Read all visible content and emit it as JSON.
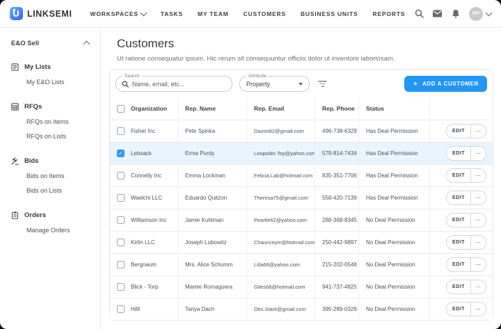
{
  "brand": {
    "name": "LINKSEMI"
  },
  "topnav": {
    "items": [
      "WORKSPACES",
      "TASKS",
      "MY TEAM",
      "CUSTOMERS",
      "BUSINESS UNITS",
      "REPORTS"
    ],
    "avatar_initials": "OP"
  },
  "sidebar": {
    "title": "E&O Sell",
    "sections": [
      {
        "label": "My Lists",
        "icon": "list-icon",
        "items": [
          "My E&O Lists"
        ]
      },
      {
        "label": "RFQs",
        "icon": "grid-icon",
        "items": [
          "RFQs on Items",
          "RFQs on Lists"
        ]
      },
      {
        "label": "Bids",
        "icon": "gavel-icon",
        "items": [
          "Bids on Items",
          "Bids on Lists"
        ]
      },
      {
        "label": "Orders",
        "icon": "clipboard-icon",
        "items": [
          "Manage Orders"
        ]
      }
    ]
  },
  "main": {
    "title": "Customers",
    "subtitle": "Ut ratione consequatur ipsum. Hic rerum sit consequuntur officiis dolor ut inventore laboriosam.",
    "toolbar": {
      "search_label": "Search",
      "search_placeholder": "Name, email, etc...",
      "attribute_label": "Attribute",
      "attribute_value": "Property",
      "add_button": "ADD A CUSTOMER"
    },
    "table": {
      "columns": [
        "Organization",
        "Rep. Name",
        "Rep. Email",
        "Rep. Phone",
        "Status"
      ],
      "edit_label": "EDIT",
      "more_label": "⋯",
      "rows": [
        {
          "org": "Fisher Inc",
          "name": "Pete Spinka",
          "email": "Davon82@gmail.com",
          "phone": "496-738-6329",
          "status": "Has Deal Permission",
          "checked": false
        },
        {
          "org": "Lebsack",
          "name": "Erma Purdy",
          "email": "Leopoldo.Toy@yahoo.com",
          "phone": "579-814-7434",
          "status": "Has Deal Permission",
          "checked": true
        },
        {
          "org": "Connelly Inc",
          "name": "Emma Lockman",
          "email": "Felicia.Lab@hotmail.com",
          "phone": "835-351-7706",
          "status": "Has Deal Permission",
          "checked": false
        },
        {
          "org": "Waelchi LLC",
          "name": "Eduardo Quitzon",
          "email": "Theresa75@gmail.com",
          "phone": "558-420-7139",
          "status": "Has Deal Permission",
          "checked": false
        },
        {
          "org": "Williamson Inc",
          "name": "Jamie Kuhlman",
          "email": "Pearlie62@yahoo.com",
          "phone": "288-368-8345",
          "status": "No Deal Permission",
          "checked": false
        },
        {
          "org": "Kirlin LLC",
          "name": "Joseph Lubowitz",
          "email": "Chaunceyin@hotmail.com",
          "phone": "250-442-9897",
          "status": "No Deal Permission",
          "checked": false
        },
        {
          "org": "Bergnaum",
          "name": "Mrs. Alice Schumm",
          "email": "Lilla66@yahoo.com",
          "phone": "215-202-0548",
          "status": "No Deal Permission",
          "checked": false
        },
        {
          "org": "Blick - Torp",
          "name": "Mamie Romaguera",
          "email": "Giles68@hotmail.com",
          "phone": "941-737-4825",
          "status": "No Deal Permission",
          "checked": false
        },
        {
          "org": "Hilll",
          "name": "Tanya Dach",
          "email": "Otis.Stark@gmail.com",
          "phone": "395-289-0326",
          "status": "No Deal Permission",
          "checked": false
        }
      ]
    }
  },
  "colors": {
    "accent": "#2196f3",
    "selected_row": "#e9f4fd",
    "checkbox_checked": "#2b9bf2"
  }
}
